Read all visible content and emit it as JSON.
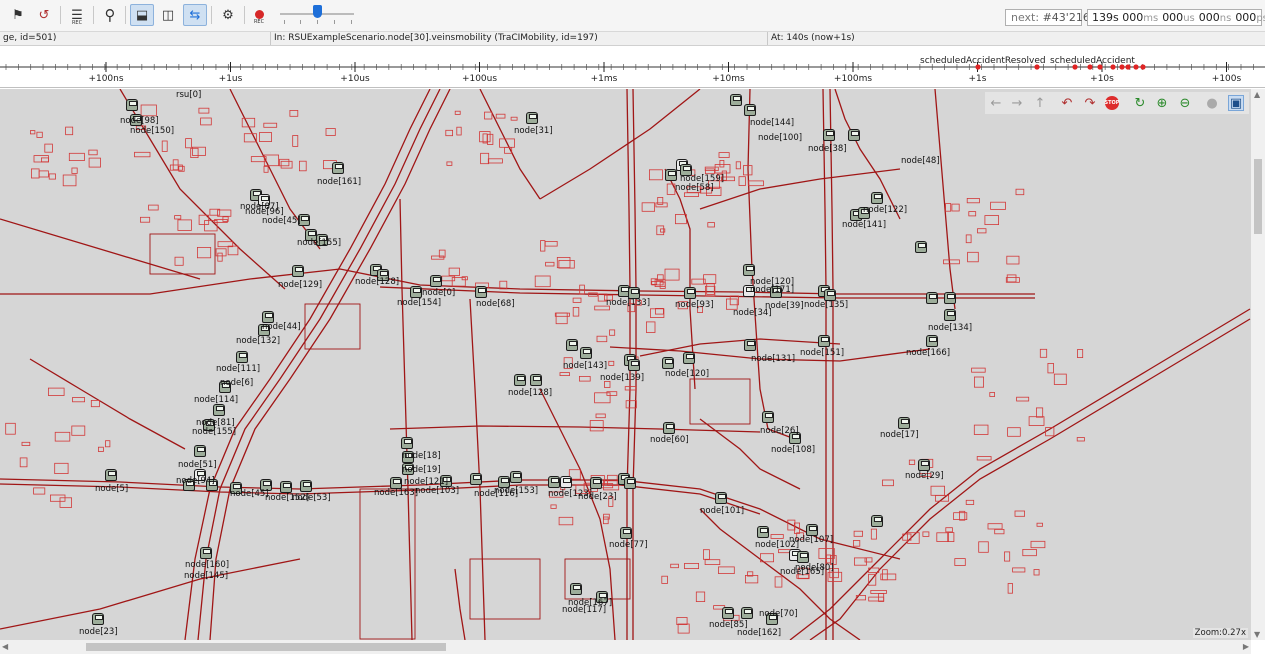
{
  "toolbar": {
    "buttons": [
      {
        "id": "run-until",
        "icon": "finish-flag-icon",
        "glyph": "⚑"
      },
      {
        "id": "rebuild",
        "icon": "rebuild-network-icon",
        "glyph": "↺"
      },
      {
        "id": "filter",
        "icon": "filter-sliders-icon",
        "glyph": "☰",
        "sub": "REC"
      },
      {
        "id": "find",
        "icon": "magnifier-icon",
        "glyph": "⚲"
      },
      {
        "id": "layout-horiz",
        "icon": "split-horizontal-icon",
        "glyph": "⬓"
      },
      {
        "id": "layout-vert",
        "icon": "split-vertical-icon",
        "glyph": "◫"
      },
      {
        "id": "animation",
        "icon": "animation-arrows-icon",
        "glyph": "⇆"
      },
      {
        "id": "settings",
        "icon": "gear-icon",
        "glyph": "⚙"
      },
      {
        "id": "record",
        "icon": "record-icon",
        "sub": "REC"
      }
    ],
    "speed_slider_value": 0.48,
    "next_event_label": "next:",
    "next_event_value": "#43'216",
    "sim_time": [
      {
        "v": "139s",
        "u": ""
      },
      {
        "v": "000",
        "u": "ms"
      },
      {
        "v": "000",
        "u": "us"
      },
      {
        "v": "000",
        "u": "ns"
      },
      {
        "v": "000",
        "u": "ps"
      }
    ]
  },
  "status": {
    "left": "ge, id=501)",
    "middle": "In: RSUExampleScenario.node[30].veinsmobility (TraCIMobility, id=197)",
    "right": "At: 140s (now+1s)"
  },
  "timeline": {
    "tick_labels": [
      "+100ns",
      "+1us",
      "+10us",
      "+100us",
      "+1ms",
      "+10ms",
      "+100ms",
      "+1s",
      "+10s",
      "+100s"
    ],
    "events": [
      "scheduledAccidentResolved",
      "scheduledAccident"
    ],
    "event_marker_color": "#e02424"
  },
  "map_tools": [
    {
      "icon": "back-arrow-icon",
      "glyph": "←"
    },
    {
      "icon": "forward-arrow-icon",
      "glyph": "→"
    },
    {
      "icon": "up-arrow-icon",
      "glyph": "↑"
    },
    {
      "icon": "step-icon",
      "glyph": "↶"
    },
    {
      "icon": "run-icon",
      "glyph": "↷"
    },
    {
      "icon": "stop-icon",
      "glyph": "STOP"
    },
    {
      "icon": "refresh-icon",
      "glyph": "↻"
    },
    {
      "icon": "zoom-in-icon",
      "glyph": "⊕"
    },
    {
      "icon": "zoom-out-icon",
      "glyph": "⊖"
    },
    {
      "icon": "layers-icon",
      "glyph": "●"
    },
    {
      "icon": "display-mode-icon",
      "glyph": "▣"
    }
  ],
  "map": {
    "zoom_label": "Zoom:0.27x",
    "road_color": "#a01616",
    "building_color": "#d23838",
    "labels": [
      "rsu[0]",
      "node[98]",
      "node[150]",
      "node[31]",
      "node[161]",
      "node[87]",
      "node[96]",
      "node[45]",
      "node[155]",
      "node[128]",
      "node[0]",
      "node[154]",
      "node[68]",
      "node[129]",
      "node[44]",
      "node[132]",
      "node[111]",
      "node[6]",
      "node[114]",
      "node[81]",
      "node[155]",
      "node[51]",
      "node[5]",
      "node[94]",
      "node[45]",
      "node[152]",
      "node[53]",
      "node[160]",
      "node[145]",
      "node[23]",
      "node[18]",
      "node[19]",
      "node[121]",
      "node[163]",
      "node[103]",
      "node[153]",
      "node[116]",
      "node[123]",
      "node[23]",
      "node[128]",
      "node[143]",
      "node[139]",
      "node[120]",
      "node[60]",
      "node[133]",
      "node[93]",
      "node[34]",
      "node[39]",
      "node[135]",
      "node[120]",
      "node[171]",
      "node[131]",
      "node[151]",
      "node[26]",
      "node[108]",
      "node[101]",
      "node[77]",
      "node[167]",
      "node[117]",
      "node[102]",
      "node[107]",
      "node[80]",
      "node[165]",
      "node[70]",
      "node[85]",
      "node[162]",
      "node[17]",
      "node[29]",
      "node[134]",
      "node[166]",
      "node[48]",
      "node[122]",
      "node[141]",
      "node[100]",
      "node[38]",
      "node[144]",
      "node[58]",
      "node[159]"
    ]
  }
}
